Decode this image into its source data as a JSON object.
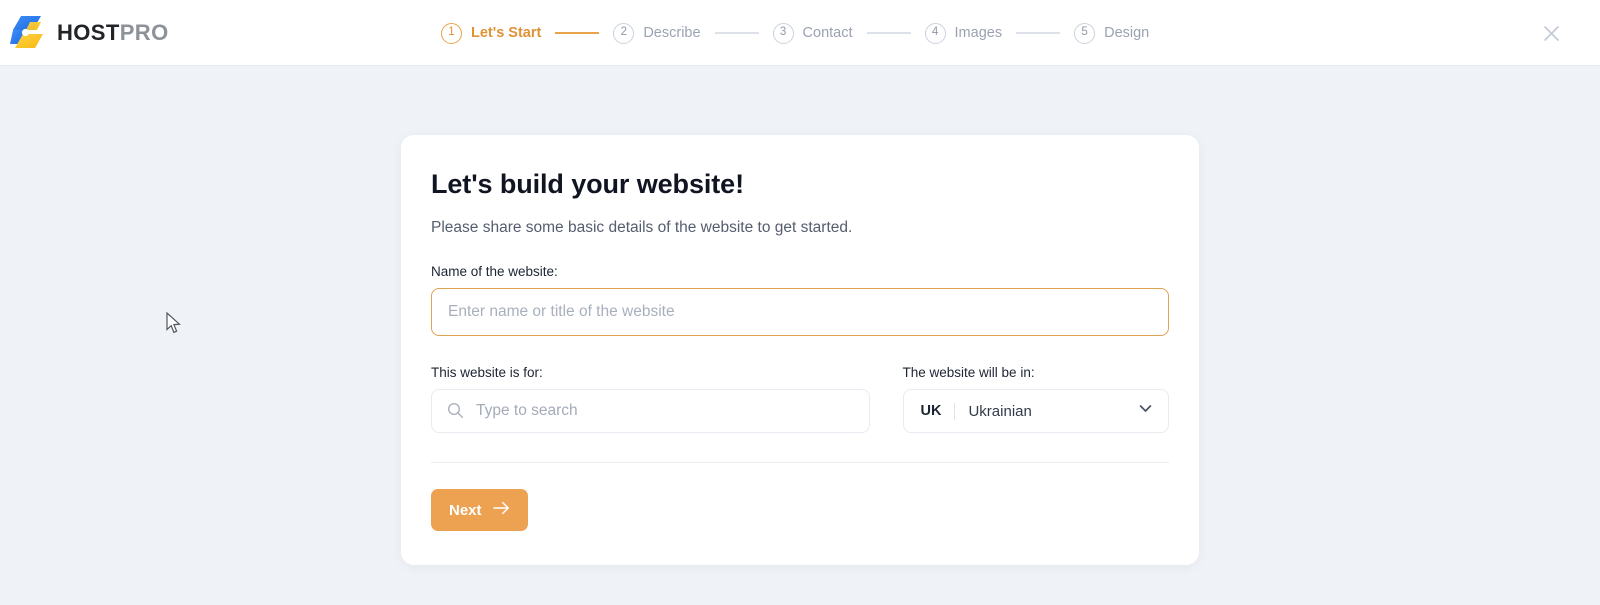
{
  "header": {
    "logo": {
      "icon": "hostpro-logo-icon",
      "text_primary": "HOST",
      "text_secondary": "PRO",
      "color_blue": "#2f7df6",
      "color_yellow": "#fbc62f"
    },
    "close_icon": "close-icon",
    "steps": [
      {
        "number": "1",
        "label": "Let's Start",
        "active": true
      },
      {
        "number": "2",
        "label": "Describe",
        "active": false
      },
      {
        "number": "3",
        "label": "Contact",
        "active": false
      },
      {
        "number": "4",
        "label": "Images",
        "active": false
      },
      {
        "number": "5",
        "label": "Design",
        "active": false
      }
    ],
    "active_color": "#e09236",
    "inactive_color": "#9aa2b1"
  },
  "card": {
    "title": "Let's build your website!",
    "subtitle": "Please share some basic details of the website to get started.",
    "name_field": {
      "label": "Name of the website:",
      "value": "",
      "placeholder": "Enter name or title of the website",
      "focused": true,
      "border_color": "#e0a154"
    },
    "purpose_field": {
      "label": "This website is for:",
      "value": "",
      "placeholder": "Type to search",
      "icon": "search-icon"
    },
    "language_field": {
      "label": "The website will be in:",
      "code": "UK",
      "name": "Ukrainian",
      "icon": "chevron-down-icon"
    },
    "next_button": {
      "label": "Next",
      "icon": "arrow-right-icon",
      "color": "#eda252"
    }
  },
  "page": {
    "background": "#eff2f7",
    "cursor": "mouse-pointer"
  }
}
